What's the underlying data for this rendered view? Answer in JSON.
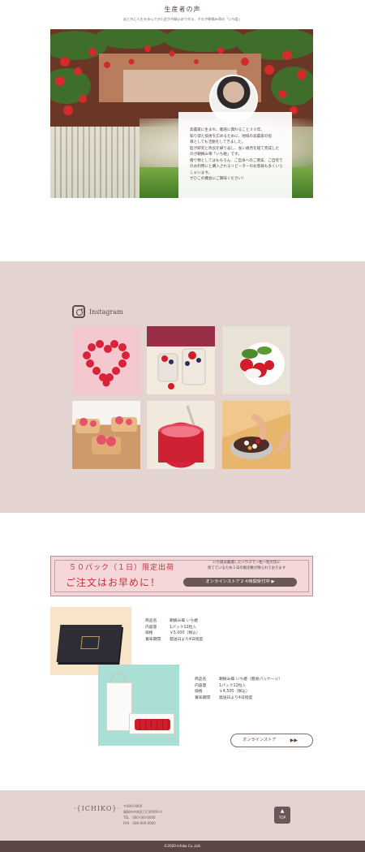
{
  "voice": {
    "title": "生産者の声",
    "subtitle": "岩と共に人生を歩んできた匠が丹精込めて作る、それが朝摘み苺の「いち姫」",
    "message_lines": [
      "高農家に生まれ、栽培に関わること３０年。",
      "知り得た技術を広めるために、地域の高農家の指",
      "導としても活動をしてきました。",
      "匠が研究と改良を繰り返し、長い歳月を経て完成した",
      "のが朝摘み苺「いち姫」です。",
      "贈り物としてはもちろん、ご自身へのご褒美、ご自宅で",
      "のお利用にと購入されるリピーターのお客様も多くいら",
      "しゃいます。",
      "ぜひこの機会にご賞味ください！"
    ]
  },
  "instagram": {
    "label": "Instagram"
  },
  "banner": {
    "line1": "５０パック（１日）限定出荷",
    "line2": "ご注文はお早めに！",
    "note_line1": "いち姫は厳選したハウスで一粒一粒大切に",
    "note_line2": "育てているため１日の販売数が限られております",
    "badge": "オンラインストア２４時間受付中 ▶"
  },
  "products": [
    {
      "rows": [
        {
          "k": "商品名",
          "v": "朝摘み苺 いち姫"
        },
        {
          "k": "内容量",
          "v": "1パック12粒入"
        },
        {
          "k": "価格",
          "v": "￥5,000（税込）"
        },
        {
          "k": "賞味期間",
          "v": "発送日より4日程度"
        }
      ]
    },
    {
      "rows": [
        {
          "k": "商品名",
          "v": "朝摘み苺 いち姫（簡易パッケージ）"
        },
        {
          "k": "内容量",
          "v": "1パック12粒入"
        },
        {
          "k": "価格",
          "v": "￥4,500（税込）"
        },
        {
          "k": "賞味期間",
          "v": "発送日より4日程度"
        }
      ]
    }
  ],
  "store_button": {
    "label": "オンラインストア",
    "arrow": "▶▶"
  },
  "footer": {
    "logo": "ICHIKO",
    "address_lines": [
      "〒000-0000",
      "福岡市中央区〇〇町000-0",
      "TEL　000-000-0000",
      "FAX　000-000-0000"
    ],
    "top_label": "TOP",
    "top_arrow": "▲",
    "copyright": "©2020 Ichiko Co.,Ltd."
  },
  "colors": {
    "section_bg": "#e3d4d2",
    "accent_red": "#c2303e",
    "dark_brown": "#5c4644"
  }
}
